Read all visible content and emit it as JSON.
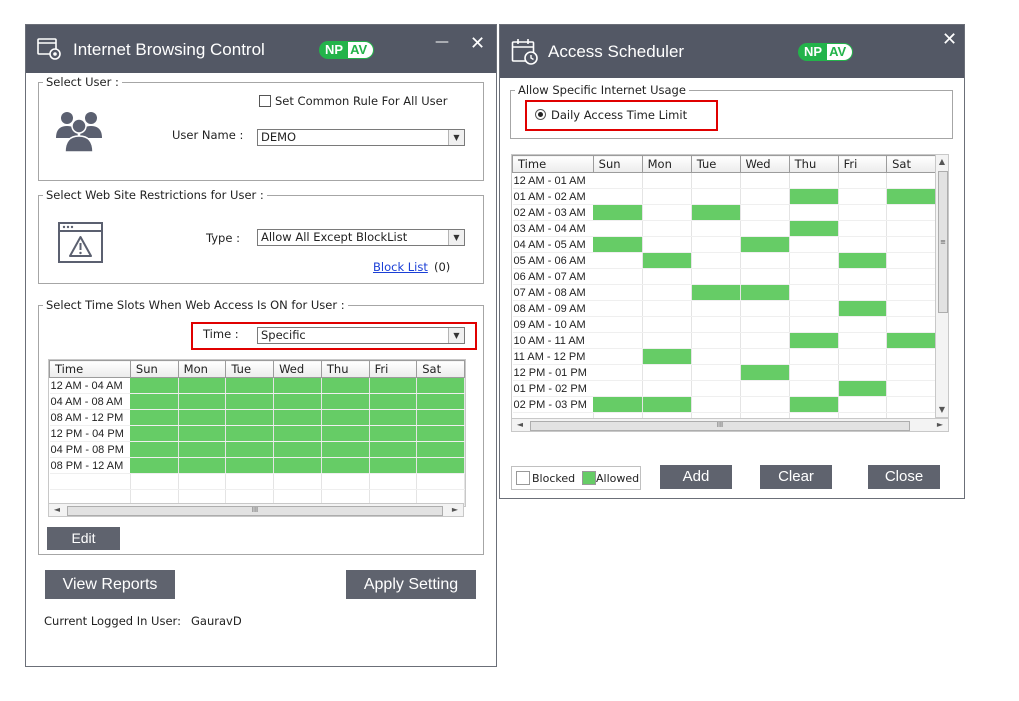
{
  "left_window": {
    "title": "Internet Browsing Control",
    "logo_np": "NP",
    "logo_av": "AV",
    "minimize_label": "—",
    "close_label": "✕",
    "select_user": {
      "legend": "Select User :",
      "common_rule_label": "Set Common Rule For All User",
      "common_rule_checked": false,
      "user_name_label": "User Name :",
      "user_name_value": "DEMO"
    },
    "web_restrictions": {
      "legend": "Select Web Site Restrictions for User :",
      "type_label": "Type :",
      "type_value": "Allow All Except BlockList",
      "block_list_link": "Block List",
      "block_list_count": "(0)"
    },
    "time_slots": {
      "legend": "Select Time Slots When Web Access Is ON for User :",
      "time_label": "Time :",
      "time_value": "Specific",
      "columns": [
        "Time",
        "Sun",
        "Mon",
        "Tue",
        "Wed",
        "Thu",
        "Fri",
        "Sat"
      ],
      "rows": [
        {
          "time": "12 AM - 04 AM",
          "allowed": [
            1,
            1,
            1,
            1,
            1,
            1,
            1
          ]
        },
        {
          "time": "04 AM - 08 AM",
          "allowed": [
            1,
            1,
            1,
            1,
            1,
            1,
            1
          ]
        },
        {
          "time": "08 AM - 12 PM",
          "allowed": [
            1,
            1,
            1,
            1,
            1,
            1,
            1
          ]
        },
        {
          "time": "12 PM - 04 PM",
          "allowed": [
            1,
            1,
            1,
            1,
            1,
            1,
            1
          ]
        },
        {
          "time": "04 PM - 08 PM",
          "allowed": [
            1,
            1,
            1,
            1,
            1,
            1,
            1
          ]
        },
        {
          "time": "08 PM - 12 AM",
          "allowed": [
            1,
            1,
            1,
            1,
            1,
            1,
            1
          ]
        }
      ],
      "edit_button": "Edit"
    },
    "view_reports_button": "View Reports",
    "apply_setting_button": "Apply Setting",
    "logged_in_label": "Current Logged In User:",
    "logged_in_user": "GauravD"
  },
  "right_window": {
    "title": "Access Scheduler",
    "logo_np": "NP",
    "logo_av": "AV",
    "close_label": "✕",
    "usage_legend": "Allow Specific Internet Usage",
    "radio_label": "Daily Access Time Limit",
    "radio_selected": true,
    "columns": [
      "Time",
      "Sun",
      "Mon",
      "Tue",
      "Wed",
      "Thu",
      "Fri",
      "Sat"
    ],
    "rows": [
      {
        "time": "12 AM - 01 AM",
        "allowed": [
          0,
          0,
          0,
          0,
          0,
          0,
          0
        ]
      },
      {
        "time": "01 AM - 02 AM",
        "allowed": [
          0,
          0,
          0,
          0,
          1,
          0,
          1
        ]
      },
      {
        "time": "02 AM - 03 AM",
        "allowed": [
          1,
          0,
          1,
          0,
          0,
          0,
          0
        ]
      },
      {
        "time": "03 AM - 04 AM",
        "allowed": [
          0,
          0,
          0,
          0,
          1,
          0,
          0
        ]
      },
      {
        "time": "04 AM - 05 AM",
        "allowed": [
          1,
          0,
          0,
          1,
          0,
          0,
          0
        ]
      },
      {
        "time": "05 AM - 06 AM",
        "allowed": [
          0,
          1,
          0,
          0,
          0,
          1,
          0
        ]
      },
      {
        "time": "06 AM - 07 AM",
        "allowed": [
          0,
          0,
          0,
          0,
          0,
          0,
          0
        ]
      },
      {
        "time": "07 AM - 08 AM",
        "allowed": [
          0,
          0,
          1,
          1,
          0,
          0,
          0
        ]
      },
      {
        "time": "08 AM - 09 AM",
        "allowed": [
          0,
          0,
          0,
          0,
          0,
          1,
          0
        ]
      },
      {
        "time": "09 AM - 10 AM",
        "allowed": [
          0,
          0,
          0,
          0,
          0,
          0,
          0
        ]
      },
      {
        "time": "10 AM - 11 AM",
        "allowed": [
          0,
          0,
          0,
          0,
          1,
          0,
          1
        ]
      },
      {
        "time": "11 AM - 12 PM",
        "allowed": [
          0,
          1,
          0,
          0,
          0,
          0,
          0
        ]
      },
      {
        "time": "12 PM - 01 PM",
        "allowed": [
          0,
          0,
          0,
          1,
          0,
          0,
          0
        ]
      },
      {
        "time": "01 PM - 02 PM",
        "allowed": [
          0,
          0,
          0,
          0,
          0,
          1,
          0
        ]
      },
      {
        "time": "02 PM - 03 PM",
        "allowed": [
          1,
          1,
          0,
          0,
          1,
          0,
          0
        ]
      }
    ],
    "legend_blocked": "Blocked",
    "legend_allowed": "Allowed",
    "add_button": "Add",
    "clear_button": "Clear",
    "close_button": "Close"
  },
  "colors": {
    "titlebar": "#535865",
    "allowed": "#66cc66",
    "button": "#5f636e",
    "highlight": "#e00000",
    "brand_green": "#23b34a"
  }
}
